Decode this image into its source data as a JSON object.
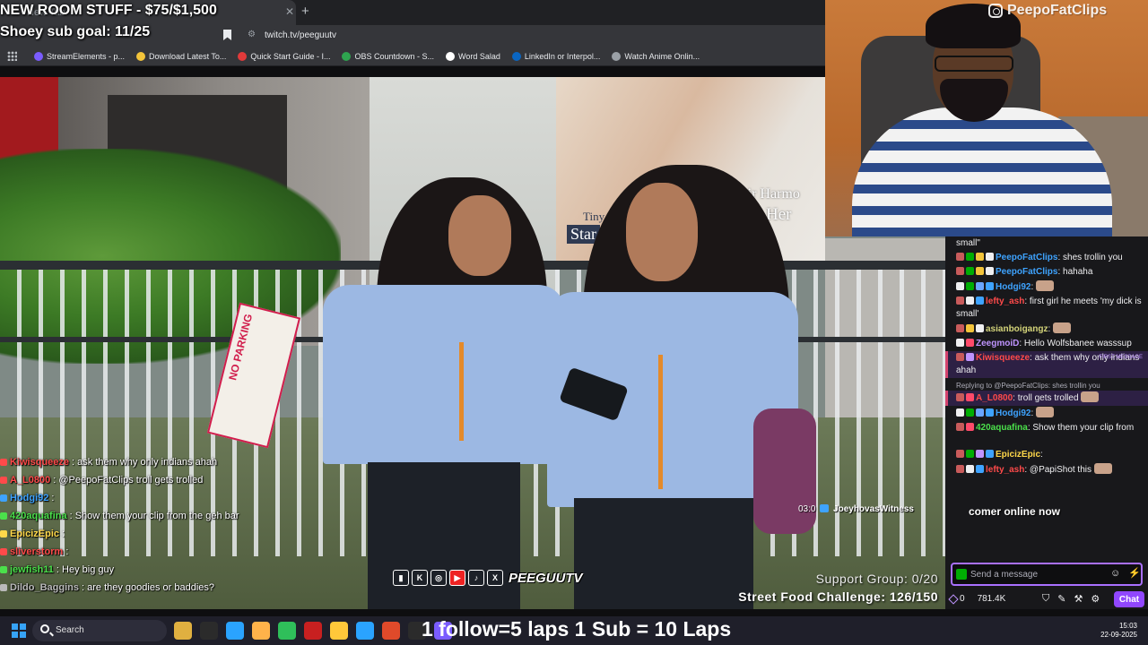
{
  "overlay": {
    "title": "NEW ROOM STUFF - $75/$1,500",
    "goal": "Shoey sub goal: 11/25",
    "online": "comer online now"
  },
  "browser": {
    "tab_title": "New Tab",
    "url": "twitch.tv/peeguutv",
    "bookmarks": [
      {
        "label": "StreamElements - p...",
        "color": "#7a5cff"
      },
      {
        "label": "Download Latest To...",
        "color": "#f3c43a"
      },
      {
        "label": "Quick Start Guide - I...",
        "color": "#e23a3a"
      },
      {
        "label": "OBS Countdown - S...",
        "color": "#2ea44f"
      },
      {
        "label": "Word Salad",
        "color": "#ffffff"
      },
      {
        "label": "LinkedIn or Interpol...",
        "color": "#0a66c2"
      },
      {
        "label": "Watch Anime Onlin...",
        "color": "#9aa0a6"
      }
    ]
  },
  "billboard": {
    "line1": "Hair Harmo",
    "line2": "Starts Her",
    "line3": "Tiny",
    "line4": "Star"
  },
  "sign": {
    "text": "NO PARKING"
  },
  "video_chat": [
    {
      "name": "Kiwisqueeze",
      "text": ": ask them why only indians ahah",
      "color": "#ff4a4a"
    },
    {
      "name": "A_L0800",
      "text": ": @PeepoFatClips troll gets trolled",
      "color": "#ff4a4a"
    },
    {
      "name": "Hodgi92",
      "text": ":",
      "color": "#3ea3ff"
    },
    {
      "name": "420aquafina",
      "text": ": Show them your clip from the geh bar",
      "color": "#4be04b"
    },
    {
      "name": "EpicizEpic",
      "text": ":",
      "color": "#ffd84a"
    },
    {
      "name": "sliverstorm",
      "text": ":",
      "color": "#ff4a4a"
    },
    {
      "name": "jewfish11",
      "text": ": Hey big guy",
      "color": "#4be04b"
    },
    {
      "name": "Dildo_Baggins",
      "text": ": are they goodies or baddies?",
      "color": "#b9b9b9"
    }
  ],
  "social_logo": "PEEGUUTV",
  "joey": {
    "time": "03:0",
    "name": "JoeyhovasWitness"
  },
  "goals": {
    "support": "Support Group: 0/20",
    "street": "Street Food Challenge: 126/150"
  },
  "webcam": {
    "watermark": "PeepoFatClips"
  },
  "chat": {
    "messages": [
      {
        "name": "",
        "text": "small\"",
        "color": "#efeff1",
        "badges": []
      },
      {
        "name": "PeepoFatClips",
        "text": ": shes trollin you",
        "color": "#3ea3ff",
        "badges": [
          "#c85b5b",
          "#00ad03",
          "#f3c43a",
          "#efeff1"
        ]
      },
      {
        "name": "PeepoFatClips",
        "text": ": hahaha",
        "color": "#3ea3ff",
        "badges": [
          "#c85b5b",
          "#00ad03",
          "#f3c43a",
          "#efeff1"
        ]
      },
      {
        "name": "Hodgi92",
        "text": ":",
        "color": "#3ea3ff",
        "badges": [
          "#efeff1",
          "#00ad03",
          "#6aa6ff",
          "#3ea3ff"
        ],
        "emote": true
      },
      {
        "name": "lefty_ash",
        "text": ": first girl he meets 'my dick is small'",
        "color": "#ff4a4a",
        "badges": [
          "#c85b5b",
          "#efeff1",
          "#3ea3ff"
        ]
      },
      {
        "name": "asianboigangz",
        "text": ":",
        "color": "#d4d47a",
        "badges": [
          "#c85b5b",
          "#f3c43a",
          "#efeff1"
        ],
        "emote": true
      },
      {
        "name": "ZeegmoiD",
        "text": ": Hello Wolfsbanee wasssup",
        "color": "#bf94ff",
        "badges": [
          "#efeff1",
          "#ff4a6a"
        ]
      },
      {
        "name": "Kiwisqueeze",
        "text": ": ask them why only indians ahah",
        "color": "#ff4a4a",
        "badges": [
          "#c85b5b",
          "#bf94ff"
        ],
        "highlight": true,
        "tag": "FIRST MESSAGE"
      },
      {
        "name": "A_L0800",
        "text": ": troll gets trolled",
        "color": "#ff4a4a",
        "badges": [
          "#c85b5b",
          "#ff4a6a"
        ],
        "highlight": true,
        "reply": "Replying to @PeepoFatClips: shes trollin you",
        "emote": true
      },
      {
        "name": "Hodgi92",
        "text": ":",
        "color": "#3ea3ff",
        "badges": [
          "#efeff1",
          "#00ad03",
          "#6aa6ff",
          "#3ea3ff"
        ],
        "emote": true
      },
      {
        "name": "420aquafina",
        "text": ": Show them your clip from",
        "color": "#4be04b",
        "badges": [
          "#c85b5b",
          "#ff4a6a"
        ]
      },
      {
        "name": "",
        "text": "",
        "color": "#efeff1",
        "badges": []
      },
      {
        "name": "EpicizEpic",
        "text": ":",
        "color": "#ffd84a",
        "badges": [
          "#c85b5b",
          "#00ad03",
          "#bf94ff",
          "#3ea3ff"
        ]
      },
      {
        "name": "lefty_ash",
        "text": ": @PapiShot this",
        "color": "#ff4a4a",
        "badges": [
          "#c85b5b",
          "#efeff1",
          "#3ea3ff"
        ],
        "emote": true
      }
    ],
    "input_placeholder": "Send a message",
    "points": "0",
    "viewers": "781.4K",
    "chat_button": "Chat"
  },
  "taskbar": {
    "search_label": "Search",
    "marquee": "1 follow=5 laps 1 Sub = 10 Laps",
    "time": "15:03",
    "date": "22-09-2025",
    "app_colors": [
      "#e0b040",
      "#2b2b2b",
      "#2aa3ff",
      "#ffb24a",
      "#2fbf5a",
      "#c82020",
      "#ffc83a",
      "#2aa3ff",
      "#e04a2a",
      "#2b2b2b",
      "#7a5cff"
    ]
  }
}
